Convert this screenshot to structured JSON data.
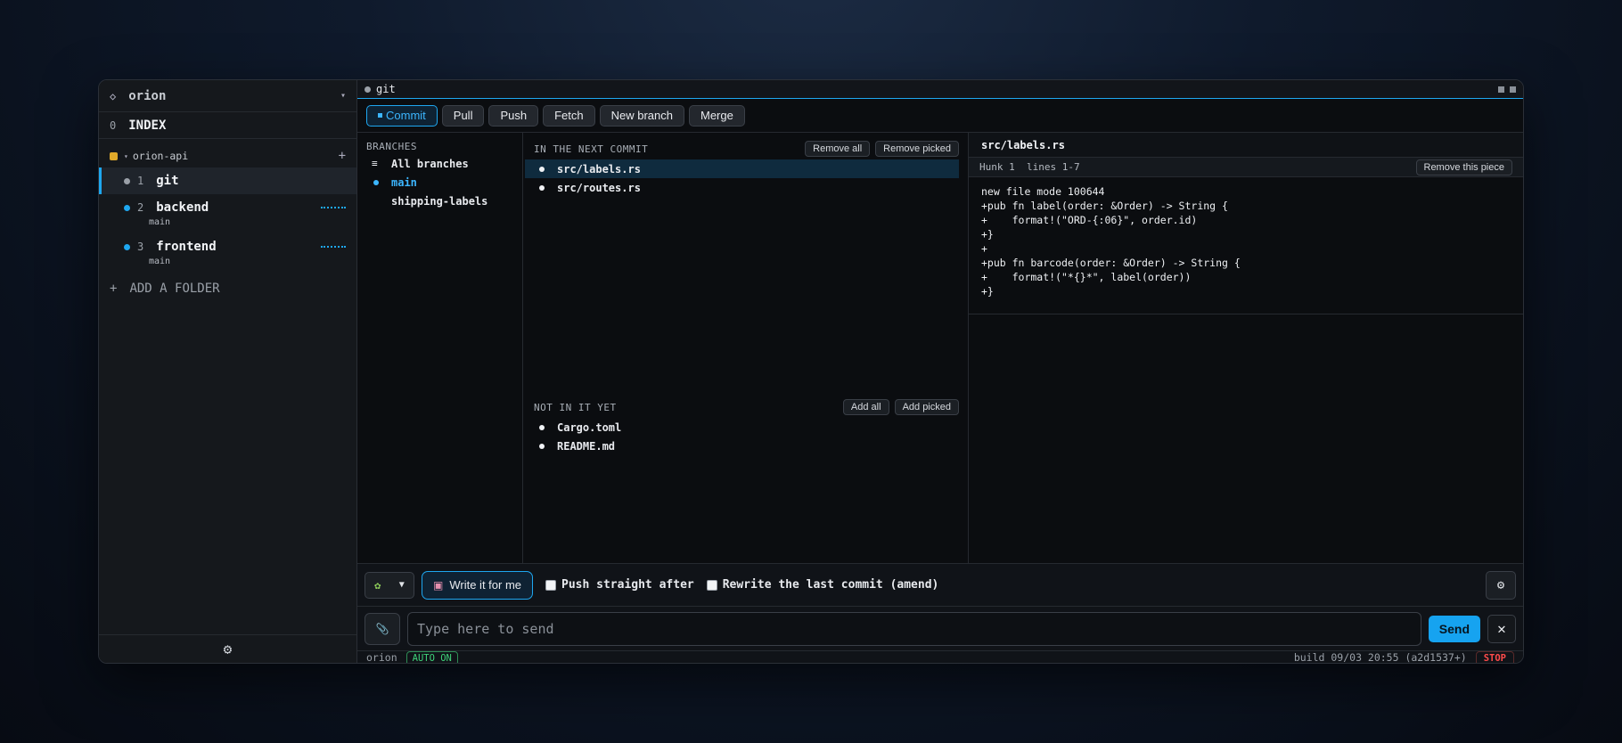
{
  "workspace": {
    "name": "orion"
  },
  "sidebar": {
    "index_num": "0",
    "index_label": "INDEX",
    "group": {
      "name": "orion-api"
    },
    "sessions": [
      {
        "num": "1",
        "name": "git",
        "sub": "",
        "dot_color": "#9aa0a8",
        "active": true
      },
      {
        "num": "2",
        "name": "backend",
        "sub": "main",
        "dot_color": "#1ea7f0"
      },
      {
        "num": "3",
        "name": "frontend",
        "sub": "main",
        "dot_color": "#1ea7f0"
      }
    ],
    "add_folder": "ADD A FOLDER"
  },
  "titlebar": {
    "title": "git"
  },
  "toolbar": {
    "buttons": [
      "Commit",
      "Pull",
      "Push",
      "Fetch",
      "New branch",
      "Merge"
    ]
  },
  "branches": {
    "title": "BRANCHES",
    "all": "All branches",
    "items": [
      "main",
      "shipping-labels"
    ]
  },
  "next_commit": {
    "title": "IN THE NEXT COMMIT",
    "remove_all": "Remove all",
    "remove_picked": "Remove picked",
    "files": [
      "src/labels.rs",
      "src/routes.rs"
    ]
  },
  "not_yet": {
    "title": "NOT IN IT YET",
    "add_all": "Add all",
    "add_picked": "Add picked",
    "files": [
      "Cargo.toml",
      "README.md"
    ]
  },
  "diff": {
    "file": "src/labels.rs",
    "hunk": "Hunk 1  lines 1-7",
    "remove_piece": "Remove this piece",
    "lines": "new file mode 100644\n+pub fn label(order: &Order) -> String {\n+    format!(\"ORD-{:06}\", order.id)\n+}\n+\n+pub fn barcode(order: &Order) -> String {\n+    format!(\"*{}*\", label(order))\n+}"
  },
  "commit_bar": {
    "write_label": "Write it for me",
    "push_after": "Push straight after",
    "amend": "Rewrite the last commit (amend)"
  },
  "input": {
    "placeholder": "Type here to send",
    "send": "Send"
  },
  "status": {
    "name": "orion",
    "auto": "AUTO ON",
    "build": "build 09/03 20:55 (a2d1537+)",
    "stop": "STOP"
  },
  "colors": {
    "accent": "#1ea7f0",
    "folder": "#e0a92a",
    "ok": "#3fd37a",
    "danger": "#ff4b4b"
  }
}
